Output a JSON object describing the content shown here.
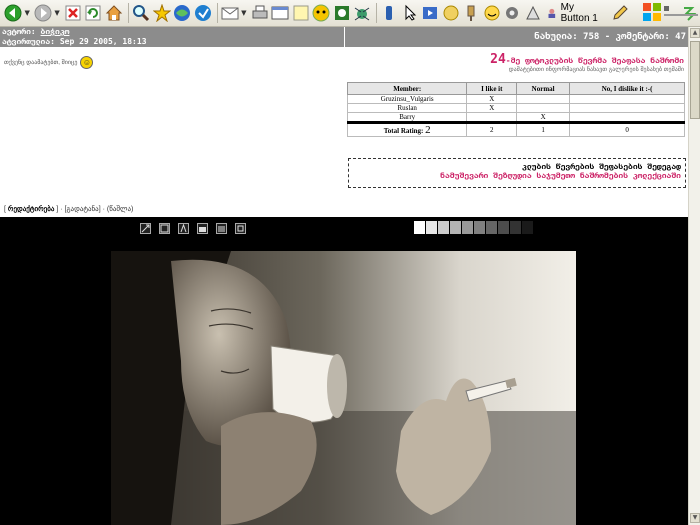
{
  "toolbar": {
    "my_button_label": "My Button 1",
    "icons": [
      "back-icon",
      "forward-icon",
      "stop-icon",
      "refresh-icon",
      "home-icon",
      "search-icon",
      "favorites-star-icon",
      "media-icon",
      "history-icon",
      "mail-icon",
      "print-icon",
      "edit-icon",
      "discuss-icon",
      "messenger-icon",
      "research-icon",
      "spider-icon",
      "bluetooth-icon",
      "cursor-icon",
      "media-player-icon",
      "thumbs-icon",
      "smiley-icon",
      "pin-icon",
      "gear-icon",
      "pencil-icon",
      "wireless-icon"
    ]
  },
  "header": {
    "author_label": "ავტორი:",
    "author_value": "ბიჭიკო",
    "date_label": "ატვირთულია:",
    "date_value": "Sep 29 2005, 18:13",
    "stats": "ნახულია: 758 - კომენტარი: 47"
  },
  "favorites": {
    "label": "თქვენც დაამატებთ, შიიცე",
    "icon": "smiley-icon"
  },
  "contest": {
    "number": "24",
    "title": "-მე ფოტოკლუბის წევრმა შეაფასა ნაშრომი",
    "subtitle": "დამატებითი ინფორმაციას ნახავთ გალერეის შესახებ თემაში"
  },
  "rating": {
    "headers": [
      "Member:",
      "I like it",
      "Normal",
      "No, I dislike it :-("
    ],
    "rows": [
      [
        "Gruzinsu_Vulgaris",
        "X",
        "",
        ""
      ],
      [
        "Ruslan",
        "X",
        "",
        ""
      ],
      [
        "Barry",
        "",
        "X",
        ""
      ]
    ],
    "total_label": "Total Rating:",
    "total_value": "2",
    "totals": [
      "2",
      "1",
      "0"
    ]
  },
  "notice": {
    "line1": "კლუბის წევრების შეფასების შედეგად",
    "line2": "ნამუშევარი შეზღუდია საჯუმეთო ნაშრომების კოლექციაში"
  },
  "nav": {
    "link1": "რედაქტირება",
    "link2": "[გადატანა]",
    "link3": "(წაშლა)"
  },
  "viewer": {
    "tools": [
      "resize-icon",
      "fullscreen-icon",
      "exif-icon",
      "folder-icon",
      "grid-icon",
      "crop-icon"
    ],
    "swatches": [
      "#ffffff",
      "#e6e6e6",
      "#cccccc",
      "#b3b3b3",
      "#999999",
      "#808080",
      "#666666",
      "#4d4d4d",
      "#333333",
      "#1a1a1a"
    ]
  },
  "photo": {
    "icon": "photo-elderly-woman-drinking"
  }
}
